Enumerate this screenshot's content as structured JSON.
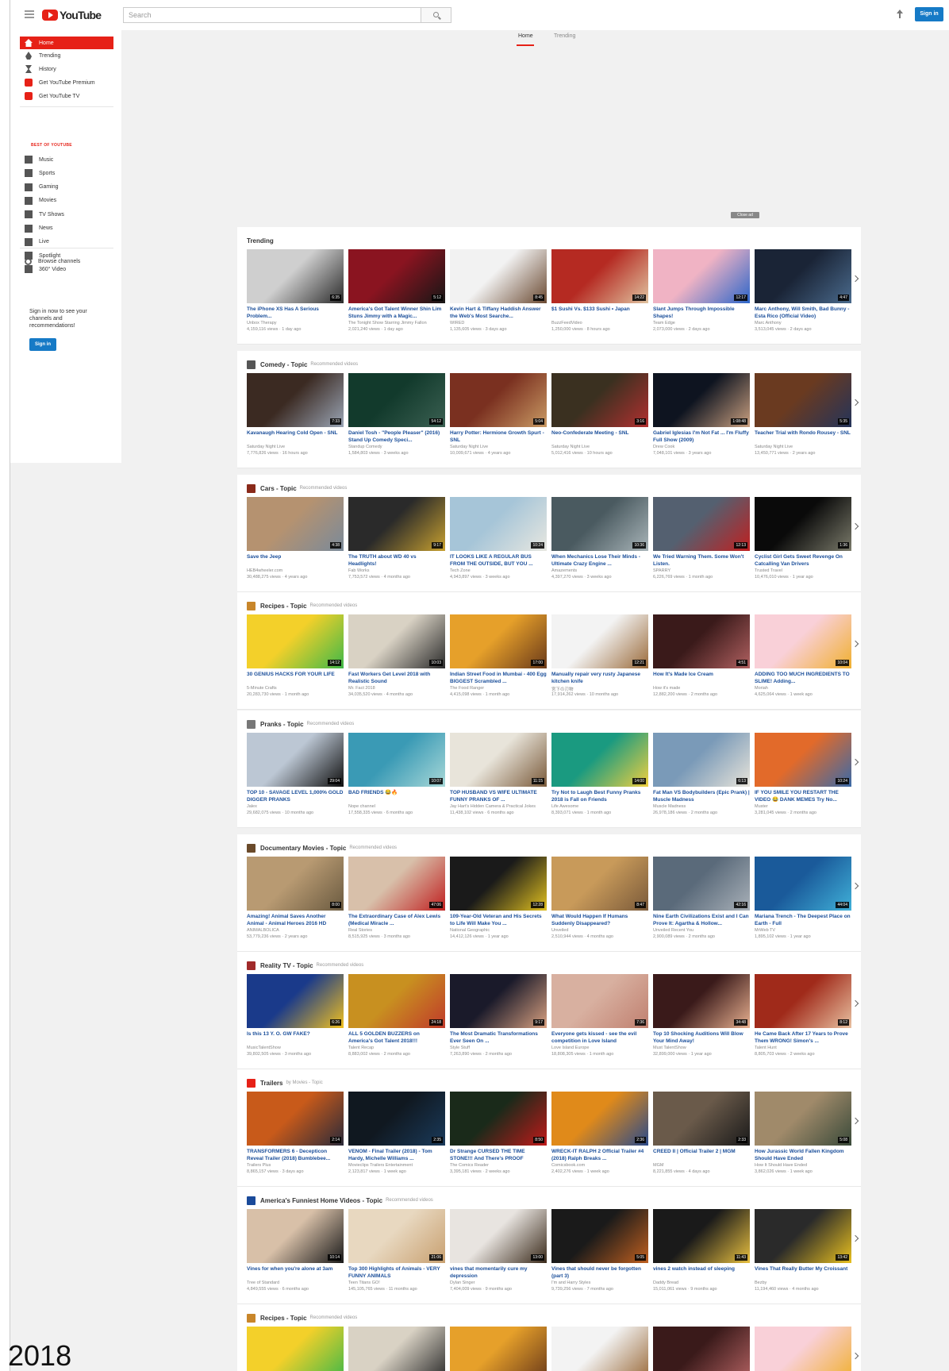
{
  "header": {
    "logo_text": "YouTube",
    "search_placeholder": "Search",
    "signin_label": "Sign in"
  },
  "tabs": [
    "Home",
    "Trending"
  ],
  "sidebar": {
    "items": [
      {
        "label": "Home",
        "icon": "home-icon",
        "active": true
      },
      {
        "label": "Trending",
        "icon": "flame-icon"
      },
      {
        "label": "History",
        "icon": "history-icon"
      },
      {
        "label": "Get YouTube Premium",
        "icon": "youtube-icon"
      },
      {
        "label": "Get YouTube TV",
        "icon": "youtube-tv-icon"
      }
    ],
    "best_of_label": "BEST OF YOUTUBE",
    "best_of": [
      "Music",
      "Sports",
      "Gaming",
      "Movies",
      "TV Shows",
      "News",
      "Live",
      "Spotlight",
      "360° Video"
    ],
    "browse_channels": "Browse channels",
    "signin_text": "Sign in now to see your channels and recommendations!",
    "signin_button": "Sign in"
  },
  "close_ad": "Close ad",
  "shelves": [
    {
      "title": "Trending",
      "subtitle": "",
      "icon_color": "",
      "videos": [
        {
          "title": "The iPhone XS Has A Serious Problem...",
          "channel": "Unbox Therapy",
          "meta": "4,159,116 views · 1 day ago",
          "duration": "6:35",
          "colors": [
            "#cfcfcf",
            "#2b2b2b"
          ]
        },
        {
          "title": "America's Got Talent Winner Shin Lim Stuns Jimmy with a Magic...",
          "channel": "The Tonight Show Starring Jimmy Fallon",
          "meta": "2,021,240 views · 1 day ago",
          "duration": "5:12",
          "colors": [
            "#8a1420",
            "#161616"
          ]
        },
        {
          "title": "Kevin Hart & Tiffany Haddish Answer the Web's Most Searche...",
          "channel": "WIRED",
          "meta": "1,135,605 views · 3 days ago",
          "duration": "8:45",
          "colors": [
            "#f2f2f2",
            "#6b4a32"
          ]
        },
        {
          "title": "$1 Sushi Vs. $133 Sushi • Japan",
          "channel": "BuzzFeedVideo",
          "meta": "1,250,000 views · 8 hours ago",
          "duration": "14:22",
          "colors": [
            "#b52a22",
            "#e0c3a0"
          ]
        },
        {
          "title": "Slant Jumps Through Impossible Shapes!",
          "channel": "Team Edge",
          "meta": "2,073,000 views · 2 days ago",
          "duration": "12:17",
          "colors": [
            "#f0b3c4",
            "#2d66c9"
          ]
        },
        {
          "title": "Marc Anthony, Will Smith, Bad Bunny - Esta Rico (Official Video)",
          "channel": "Marc Anthony",
          "meta": "3,513,045 views · 2 days ago",
          "duration": "4:47",
          "colors": [
            "#1a2436",
            "#4a6a8c"
          ]
        }
      ]
    },
    {
      "title": "Comedy - Topic",
      "subtitle": "Recommended videos",
      "icon_color": "#555555",
      "videos": [
        {
          "title": "Kavanaugh Hearing Cold Open - SNL",
          "channel": "Saturday Night Live",
          "meta": "7,776,826 views · 16 hours ago",
          "duration": "7:33",
          "colors": [
            "#3b2a22",
            "#9aa5b5"
          ]
        },
        {
          "title": "Daniel Tosh - \"People Pleaser\" (2016) Stand Up Comedy Speci...",
          "channel": "Standup Comedy",
          "meta": "1,584,803 views · 3 weeks ago",
          "duration": "54:12",
          "colors": [
            "#123a2c",
            "#3b6052"
          ]
        },
        {
          "title": "Harry Potter: Hermione Growth Spurt - SNL",
          "channel": "Saturday Night Live",
          "meta": "10,009,671 views · 4 years ago",
          "duration": "5:04",
          "colors": [
            "#7a3020",
            "#c99a64"
          ]
        },
        {
          "title": "Neo-Confederate Meeting - SNL",
          "channel": "Saturday Night Live",
          "meta": "5,012,416 views · 10 hours ago",
          "duration": "3:16",
          "colors": [
            "#3a3020",
            "#b23030"
          ]
        },
        {
          "title": "Gabriel Iglesias I'm Not Fat ... I'm Fluffy Full Show (2009)",
          "channel": "Drew Cook",
          "meta": "7,048,101 views · 3 years ago",
          "duration": "1:08:48",
          "colors": [
            "#0e1420",
            "#caa080"
          ]
        },
        {
          "title": "Teacher Trial with Rondo Rousey - SNL",
          "channel": "Saturday Night Live",
          "meta": "13,450,771 views · 2 years ago",
          "duration": "5:35",
          "colors": [
            "#6a3a20",
            "#24345a"
          ]
        }
      ]
    },
    {
      "title": "Cars - Topic",
      "subtitle": "Recommended videos",
      "icon_color": "#8a2a1a",
      "videos": [
        {
          "title": "Save the Jeep",
          "channel": "HEB4wheeler.com",
          "meta": "30,488,275 views · 4 years ago",
          "duration": "4:38",
          "colors": [
            "#b59270",
            "#7a8a9a"
          ]
        },
        {
          "title": "The TRUTH about WD 40 vs Headlights!",
          "channel": "Fab Works",
          "meta": "7,753,572 views · 4 months ago",
          "duration": "9:17",
          "colors": [
            "#2a2a2a",
            "#c7a030"
          ]
        },
        {
          "title": "IT LOOKS LIKE A REGULAR BUS FROM THE OUTSIDE, BUT YOU ...",
          "channel": "Tech Zone",
          "meta": "4,943,897 views · 3 weeks ago",
          "duration": "10:24",
          "colors": [
            "#a6c5d8",
            "#e7e7e0"
          ]
        },
        {
          "title": "When Mechanics Lose Their Minds - Ultimate Crazy Engine ...",
          "channel": "Amazements",
          "meta": "4,397,270 views · 3 weeks ago",
          "duration": "10:36",
          "colors": [
            "#4a5a60",
            "#a8b4b8"
          ]
        },
        {
          "title": "We Tried Warning Them. Some Won't Listen.",
          "channel": "SPARRY",
          "meta": "6,226,769 views · 1 month ago",
          "duration": "12:13",
          "colors": [
            "#546070",
            "#c02020"
          ]
        },
        {
          "title": "Cyclist Girl Gets Sweet Revenge On Catcalling Van Drivers",
          "channel": "Trusted Travel",
          "meta": "10,476,010 views · 1 year ago",
          "duration": "1:36",
          "colors": [
            "#0a0a0a",
            "#7a7a6a"
          ]
        }
      ]
    },
    {
      "title": "Recipes - Topic",
      "subtitle": "Recommended videos",
      "icon_color": "#c8862a",
      "videos": [
        {
          "title": "30 GENIUS HACKS FOR YOUR LIFE",
          "channel": "5-Minute Crafts",
          "meta": "20,283,730 views · 1 month ago",
          "duration": "14:12",
          "colors": [
            "#f3d02a",
            "#3fb848"
          ]
        },
        {
          "title": "Fast Workers Get Level 2018 with Realistic Sound",
          "channel": "Mr. Fact 2018",
          "meta": "34,035,520 views · 4 months ago",
          "duration": "10:03",
          "colors": [
            "#d9d2c4",
            "#2a2a2a"
          ]
        },
        {
          "title": "Indian Street Food in Mumbai - 400 Egg BIGGEST Scrambled ...",
          "channel": "The Food Ranger",
          "meta": "4,415,098 views · 1 month ago",
          "duration": "17:00",
          "colors": [
            "#e6a02a",
            "#6a3a1a"
          ]
        },
        {
          "title": "Manually repair very rusty Japanese kitchen knife",
          "channel": "宮下の刃物",
          "meta": "17,914,262 views · 10 months ago",
          "duration": "12:21",
          "colors": [
            "#f3f3f3",
            "#9a6a3a"
          ]
        },
        {
          "title": "How It's Made Ice Cream",
          "channel": "How it's made",
          "meta": "12,882,200 views · 2 months ago",
          "duration": "4:51",
          "colors": [
            "#3a1a1a",
            "#b06060"
          ]
        },
        {
          "title": "ADDING TOO MUCH INGREDIENTS TO SLIME! Adding...",
          "channel": "Moriah",
          "meta": "4,625,064 views · 1 week ago",
          "duration": "10:04",
          "colors": [
            "#f9d0d8",
            "#f0b030"
          ]
        }
      ]
    },
    {
      "title": "Pranks - Topic",
      "subtitle": "Recommended videos",
      "icon_color": "#777777",
      "videos": [
        {
          "title": "TOP 10 - SAVAGE LEVEL 1,000% GOLD DIGGER PRANKS",
          "channel": "Jalex",
          "meta": "29,682,075 views · 10 months ago",
          "duration": "29:04",
          "colors": [
            "#bcc7d4",
            "#101010"
          ]
        },
        {
          "title": "BAD FRIENDS 😂🔥",
          "channel": "Nope channel",
          "meta": "17,558,335 views · 6 months ago",
          "duration": "10:07",
          "colors": [
            "#3a9ab5",
            "#a8d8d8"
          ]
        },
        {
          "title": "TOP HUSBAND VS WIFE ULTIMATE FUNNY PRANKS OF ...",
          "channel": "Jay Hart's Hidden Camera & Practical Jokes",
          "meta": "11,438,102 views · 6 months ago",
          "duration": "11:15",
          "colors": [
            "#e8e4da",
            "#7a5a3a"
          ]
        },
        {
          "title": "Try Not to Laugh Best Funny Pranks 2018 is Fall on Friends",
          "channel": "Life Awesome",
          "meta": "8,393,071 views · 1 month ago",
          "duration": "14:00",
          "colors": [
            "#1a9a80",
            "#f0d040"
          ]
        },
        {
          "title": "Fat Man VS Bodybuilders (Epic Prank) | Muscle Madness",
          "channel": "Muscle Madness",
          "meta": "26,978,186 views · 2 months ago",
          "duration": "6:13",
          "colors": [
            "#7a9ab8",
            "#e8e4da"
          ]
        },
        {
          "title": "IF YOU SMILE YOU RESTART THE VIDEO 😂 DANK MEMES Try No...",
          "channel": "Muster",
          "meta": "3,281,045 views · 2 months ago",
          "duration": "10:24",
          "colors": [
            "#e26a2a",
            "#3a6aa8"
          ]
        }
      ]
    },
    {
      "title": "Documentary Movies - Topic",
      "subtitle": "Recommended videos",
      "icon_color": "#6a4a2a",
      "videos": [
        {
          "title": "Amazing! Animal Saves Another Animal - Animal Heroes 2016 HD",
          "channel": "ANIMALBOLICA",
          "meta": "53,779,236 views · 2 years ago",
          "duration": "8:00",
          "colors": [
            "#b89a72",
            "#6a5a40"
          ]
        },
        {
          "title": "The Extraordinary Case of Alex Lewis (Medical Miracle ...",
          "channel": "Real Stories",
          "meta": "8,515,925 views · 3 months ago",
          "duration": "47:06",
          "colors": [
            "#d8c0aa",
            "#c02020"
          ]
        },
        {
          "title": "109-Year-Old Veteran and His Secrets to Life Will Make You ...",
          "channel": "National Geographic",
          "meta": "14,412,126 views · 1 year ago",
          "duration": "12:28",
          "colors": [
            "#1a1a1a",
            "#e0c020"
          ]
        },
        {
          "title": "What Would Happen If Humans Suddenly Disappeared?",
          "channel": "Unveiled",
          "meta": "2,510,944 views · 4 months ago",
          "duration": "8:47",
          "colors": [
            "#c89a5a",
            "#7a5a3a"
          ]
        },
        {
          "title": "Nine Earth Civilizations Exist and I Can Prove It: Agartha & Hollow...",
          "channel": "Unveiled Recent You",
          "meta": "2,900,089 views · 2 months ago",
          "duration": "42:16",
          "colors": [
            "#5a6a7a",
            "#a8b0b8"
          ]
        },
        {
          "title": "Mariana Trench - The Deepest Place on Earth - Full",
          "channel": "MrWeb TV",
          "meta": "1,895,102 views · 1 year ago",
          "duration": "44:04",
          "colors": [
            "#1a5a9a",
            "#40b0d8"
          ]
        }
      ]
    },
    {
      "title": "Reality TV - Topic",
      "subtitle": "Recommended videos",
      "icon_color": "#a02a2a",
      "videos": [
        {
          "title": "Is this 13 Y. O. GW FAKE?",
          "channel": "MusicTalentShow",
          "meta": "39,802,505 views · 3 months ago",
          "duration": "6:26",
          "colors": [
            "#1a3a8a",
            "#f0c020"
          ]
        },
        {
          "title": "ALL 5 GOLDEN BUZZERS on America's Got Talent 2018!!!",
          "channel": "Talent Recap",
          "meta": "8,883,002 views · 2 months ago",
          "duration": "24:18",
          "colors": [
            "#c89020",
            "#c03a2a"
          ]
        },
        {
          "title": "The Most Dramatic Transformations Ever Seen On ...",
          "channel": "Style Stuff",
          "meta": "7,263,890 views · 2 months ago",
          "duration": "9:17",
          "colors": [
            "#1a1a2a",
            "#d8a080"
          ]
        },
        {
          "title": "Everyone gets kissed - see the evil competition in Love Island",
          "channel": "Love Island Europe",
          "meta": "18,808,305 views · 1 month ago",
          "duration": "7:36",
          "colors": [
            "#d8b0a0",
            "#c08070"
          ]
        },
        {
          "title": "Top 10 Shocking Auditions Will Blow Your Mind Away!",
          "channel": "Must TalentShow",
          "meta": "32,899,000 views · 1 year ago",
          "duration": "34:48",
          "colors": [
            "#3a1a1a",
            "#e8b090"
          ]
        },
        {
          "title": "He Came Back After 17 Years to Prove Them WRONG! Simon's ...",
          "channel": "Talent Hunt",
          "meta": "8,805,703 views · 2 weeks ago",
          "duration": "8:12",
          "colors": [
            "#a02a1a",
            "#e8c0a0"
          ]
        }
      ]
    },
    {
      "title": "Trailers",
      "subtitle": "by Movies - Topic",
      "icon_color": "#e62117",
      "videos": [
        {
          "title": "TRANSFORMERS 6 - Decepticon Reveal Trailer (2018) Bumblebee...",
          "channel": "Trailers Plus",
          "meta": "8,865,157 views · 3 days ago",
          "duration": "2:14",
          "colors": [
            "#c85a1a",
            "#2a2a3a"
          ]
        },
        {
          "title": "VENOM - Final Trailer (2018) - Tom Hardy, Michelle Williams ...",
          "channel": "Movieclips Trailers Entertainment",
          "meta": "2,123,817 views · 1 week ago",
          "duration": "2:35",
          "colors": [
            "#101820",
            "#1a3a5a"
          ]
        },
        {
          "title": "Dr Strange CURSED THE TIME STONE!!! And There's PROOF",
          "channel": "The Comics Reader",
          "meta": "3,395,181 views · 2 weeks ago",
          "duration": "8:50",
          "colors": [
            "#1a2a1a",
            "#c01a1a"
          ]
        },
        {
          "title": "WRECK-IT RALPH 2 Official Trailer #4 (2018) Ralph Breaks ...",
          "channel": "Comicsbook.com",
          "meta": "2,402,276 views · 1 week ago",
          "duration": "2:36",
          "colors": [
            "#e08a1a",
            "#2a4a8a"
          ]
        },
        {
          "title": "CREED II | Official Trailer 2 | MGM",
          "channel": "MGM",
          "meta": "8,221,855 views · 4 days ago",
          "duration": "2:33",
          "colors": [
            "#6a5a4a",
            "#1a1a1a"
          ]
        },
        {
          "title": "How Jurassic World Fallen Kingdom Should Have Ended",
          "channel": "How It Should Have Ended",
          "meta": "3,862,026 views · 1 week ago",
          "duration": "5:08",
          "colors": [
            "#a08a6a",
            "#3a4a3a"
          ]
        }
      ]
    },
    {
      "title": "America's Funniest Home Videos - Topic",
      "subtitle": "Recommended videos",
      "icon_color": "#1a4a9a",
      "videos": [
        {
          "title": "Vines for when you're alone at 3am",
          "channel": "Tree of Standard",
          "meta": "4,849,555 views · 6 months ago",
          "duration": "10:14",
          "colors": [
            "#d8c0a8",
            "#1a1a1a"
          ]
        },
        {
          "title": "Top 300 Highlights of Animals - VERY FUNNY ANIMALS",
          "channel": "Teen Titans GO!",
          "meta": "145,105,765 views · 11 months ago",
          "duration": "21:06",
          "colors": [
            "#e8d8c0",
            "#c8a070"
          ]
        },
        {
          "title": "vines that momentarily cure my depression",
          "channel": "Dylan Singer",
          "meta": "7,404,009 views · 9 months ago",
          "duration": "13:00",
          "colors": [
            "#e8e4e0",
            "#3a2a1a"
          ]
        },
        {
          "title": "Vines that should never be forgotten (part 3)",
          "channel": "I'm and Harry Styles",
          "meta": "9,739,256 views · 7 months ago",
          "duration": "5:05",
          "colors": [
            "#1a1a1a",
            "#c06020"
          ]
        },
        {
          "title": "vines 2 watch instead of sleeping",
          "channel": "Daddy Bread",
          "meta": "15,011,061 views · 9 months ago",
          "duration": "11:43",
          "colors": [
            "#1a1a1a",
            "#e8c040"
          ]
        },
        {
          "title": "Vines That Really Butter My Croissant",
          "channel": "Bezby",
          "meta": "11,194,460 views · 4 months ago",
          "duration": "13:42",
          "colors": [
            "#2a2a2a",
            "#e8c020"
          ]
        }
      ]
    },
    {
      "title": "Recipes - Topic",
      "subtitle": "Recommended videos",
      "icon_color": "#c8862a",
      "videos": [
        {
          "title": "",
          "channel": "",
          "meta": "",
          "duration": "",
          "colors": [
            "#f3d02a",
            "#3fb848"
          ]
        },
        {
          "title": "",
          "channel": "",
          "meta": "",
          "duration": "",
          "colors": [
            "#d9d2c4",
            "#2a2a2a"
          ]
        },
        {
          "title": "",
          "channel": "",
          "meta": "",
          "duration": "",
          "colors": [
            "#e6a02a",
            "#6a3a1a"
          ]
        },
        {
          "title": "",
          "channel": "",
          "meta": "",
          "duration": "",
          "colors": [
            "#f3f3f3",
            "#9a6a3a"
          ]
        },
        {
          "title": "",
          "channel": "",
          "meta": "",
          "duration": "",
          "colors": [
            "#3a1a1a",
            "#b06060"
          ]
        },
        {
          "title": "",
          "channel": "",
          "meta": "",
          "duration": "",
          "colors": [
            "#f9d0d8",
            "#f0b030"
          ]
        }
      ]
    }
  ],
  "caption": "2018",
  "colors": {
    "brand_red": "#e62117",
    "link_blue": "#1a4e9a",
    "signin_blue": "#167ac6"
  }
}
